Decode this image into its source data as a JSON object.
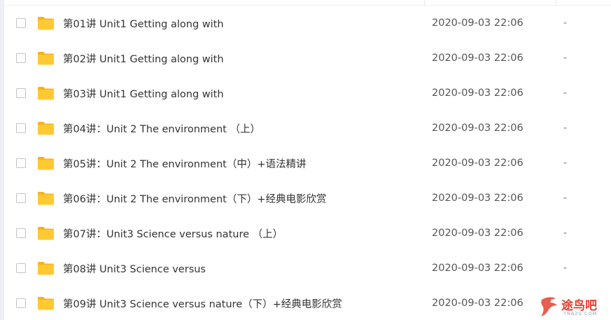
{
  "colors": {
    "folder": "#FFC933",
    "folder_tab": "#F6B21C",
    "text": "#333333",
    "date_text": "#555555",
    "watermark": "#E2422E"
  },
  "files": [
    {
      "name": "第01讲 Unit1 Getting along with",
      "modified": "2020-09-03 22:06",
      "size": "-"
    },
    {
      "name": "第02讲 Unit1 Getting along with",
      "modified": "2020-09-03 22:06",
      "size": "-"
    },
    {
      "name": "第03讲 Unit1 Getting along with",
      "modified": "2020-09-03 22:06",
      "size": "-"
    },
    {
      "name": "第04讲：Unit 2 The environment （上）",
      "modified": "2020-09-03 22:06",
      "size": "-"
    },
    {
      "name": "第05讲：Unit 2 The environment（中）+语法精讲",
      "modified": "2020-09-03 22:06",
      "size": "-"
    },
    {
      "name": "第06讲：Unit 2 The environment（下）+经典电影欣赏",
      "modified": "2020-09-03 22:06",
      "size": "-"
    },
    {
      "name": "第07讲：Unit3 Science versus nature （上）",
      "modified": "2020-09-03 22:06",
      "size": "-"
    },
    {
      "name": "第08讲 Unit3 Science versus",
      "modified": "2020-09-03 22:06",
      "size": "-"
    },
    {
      "name": "第09讲 Unit3 Science versus nature（下）+经典电影欣赏",
      "modified": "2020-09-03 22:06",
      "size": "-"
    }
  ],
  "watermark": {
    "text": "途鸟吧",
    "sub": "TNBZS.COM",
    "icon": "bird-logo-icon"
  }
}
